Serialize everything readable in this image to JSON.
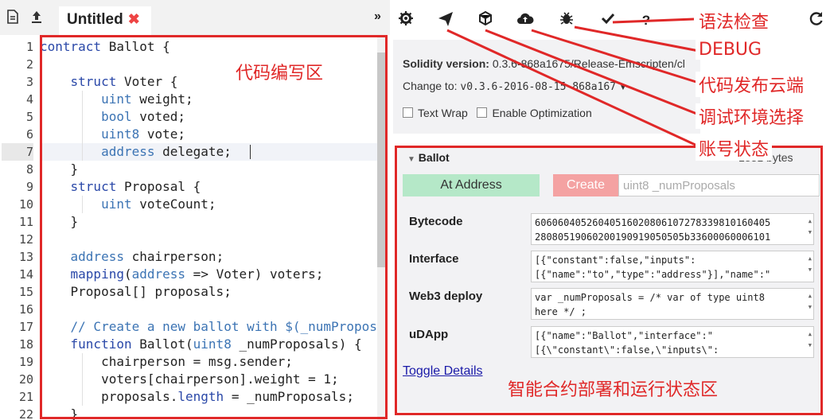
{
  "editor": {
    "tab_title": "Untitled",
    "tab_close": "✖",
    "collapse": "»",
    "line_numbers": [
      "1",
      "2",
      "3",
      "4",
      "5",
      "6",
      "7",
      "8",
      "9",
      "10",
      "11",
      "12",
      "13",
      "14",
      "15",
      "16",
      "17",
      "18",
      "19",
      "20",
      "21",
      "22"
    ],
    "active_line": 7
  },
  "settings": {
    "solidity_label": "Solidity version:",
    "solidity_value": "0.3.6-868a1675/Release-Emscripten/cl",
    "change_label": "Change to:",
    "change_value": "v0.3.6-2016-08-15-868a167",
    "text_wrap": "Text Wrap",
    "enable_optimization": "Enable Optimization"
  },
  "contract": {
    "name": "Ballot",
    "size": "1831 bytes",
    "at_address": "At Address",
    "create": "Create",
    "create_placeholder": "uint8 _numProposals",
    "bytecode_label": "Bytecode",
    "bytecode_lines": [
      "6060604052604051602080610727833981016040​5",
      "28080519060200190919050505b33600060006101"
    ],
    "interface_label": "Interface",
    "interface_lines": [
      "[{\"constant\":false,\"inputs\":",
      "[{\"name\":\"to\",\"type\":\"address\"}],\"name\":\""
    ],
    "web3_label": "Web3 deploy",
    "web3_lines": [
      "var _numProposals = /* var of type uint8",
      "here */ ;"
    ],
    "udapp_label": "uDApp",
    "udapp_lines": [
      "[{\"name\":\"Ballot\",\"interface\":\"",
      "[{\\\"constant\\\":false,\\\"inputs\\\":"
    ],
    "toggle_details": "Toggle Details"
  },
  "annotations": {
    "code_area": "代码编写区",
    "syntax_check": "语法检查",
    "debug": "DEBUG",
    "publish": "代码发布云端",
    "env": "调试环境选择",
    "account": "账号状态",
    "deploy_area": "智能合约部署和运行状态区"
  },
  "icons": {
    "file-icon": "▯",
    "upload-icon": "⬆",
    "gear-icon": "⚙",
    "send-icon": "➤",
    "box-icon": "⬢",
    "cloud-upload-icon": "☁",
    "bug-icon": "✱",
    "check-icon": "✔",
    "question-icon": "?",
    "refresh-icon": "⟳"
  },
  "colors": {
    "annotation": "#e02828",
    "keyword": "#2a48a8",
    "type": "#3c74b4",
    "at_address_bg": "#b5e8c8",
    "create_bg": "#f4a2a2"
  }
}
